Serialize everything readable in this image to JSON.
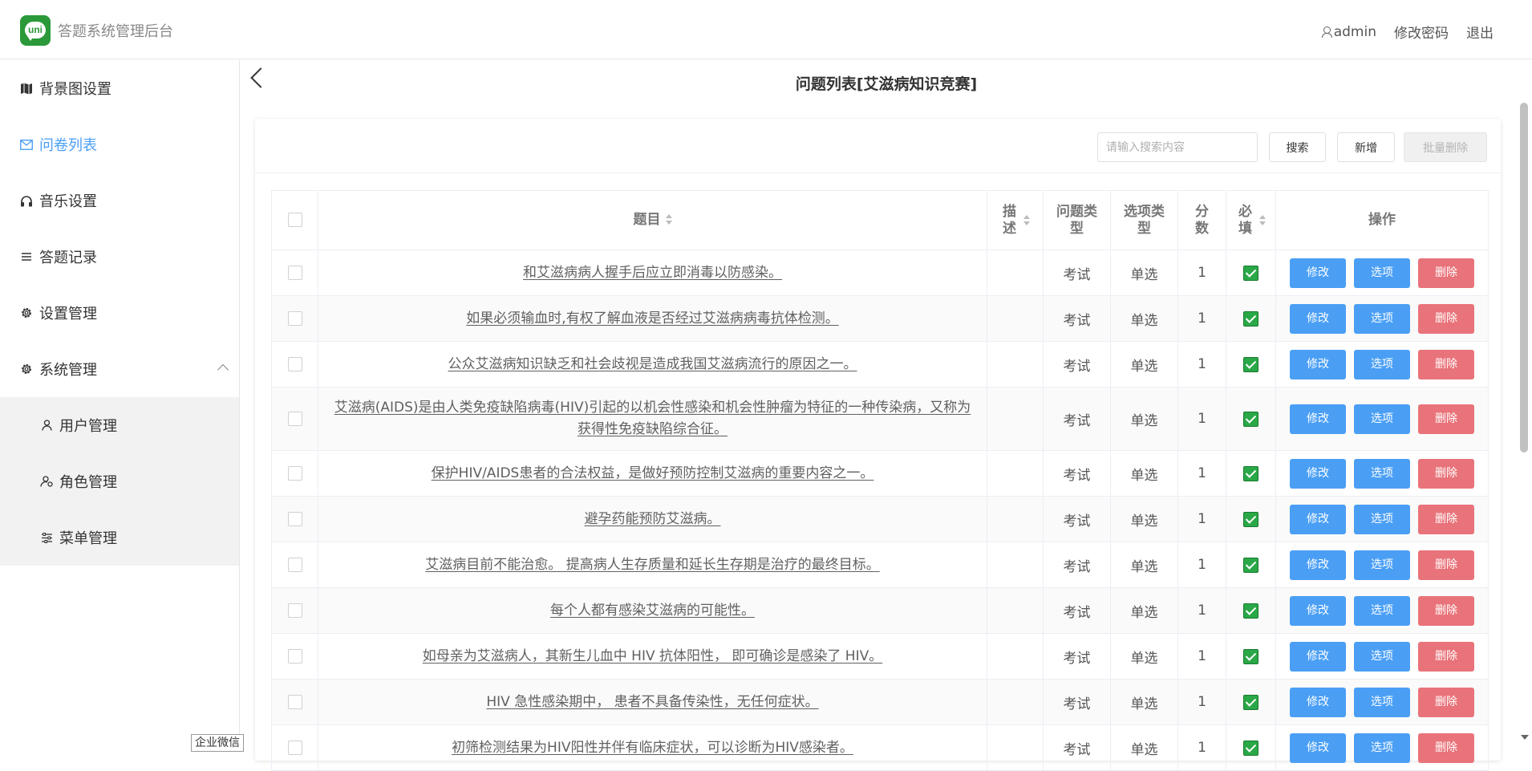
{
  "header": {
    "logo_text": "uni",
    "app_title": "答题系统管理后台",
    "username": "admin",
    "change_password": "修改密码",
    "logout": "退出"
  },
  "sidebar": {
    "items": [
      {
        "label": "背景图设置",
        "icon": "map-icon"
      },
      {
        "label": "问卷列表",
        "icon": "mail-icon",
        "active": true
      },
      {
        "label": "音乐设置",
        "icon": "headphones-icon"
      },
      {
        "label": "答题记录",
        "icon": "list-icon"
      },
      {
        "label": "设置管理",
        "icon": "gear-icon"
      },
      {
        "label": "系统管理",
        "icon": "gear-icon",
        "expanded": true
      }
    ],
    "submenu": [
      {
        "label": "用户管理",
        "icon": "user-icon"
      },
      {
        "label": "角色管理",
        "icon": "role-icon"
      },
      {
        "label": "菜单管理",
        "icon": "sliders-icon"
      }
    ]
  },
  "main": {
    "title": "问题列表[艾滋病知识竞赛]",
    "search_placeholder": "请输入搜索内容",
    "search_btn": "搜索",
    "add_btn": "新增",
    "batch_delete_btn": "批量删除"
  },
  "table": {
    "headers": {
      "question": "题目",
      "desc": "描述",
      "qtype": "问题类型",
      "otype": "选项类型",
      "score": "分数",
      "required": "必填",
      "ops": "操作"
    },
    "actions": {
      "edit": "修改",
      "options": "选项",
      "delete": "删除"
    },
    "rows": [
      {
        "question": "和艾滋病病人握手后应立即消毒以防感染。",
        "desc": "",
        "qtype": "考试",
        "otype": "单选",
        "score": "1"
      },
      {
        "question": "如果必须输血时,有权了解血液是否经过艾滋病病毒抗体检测。",
        "desc": "",
        "qtype": "考试",
        "otype": "单选",
        "score": "1"
      },
      {
        "question": "公众艾滋病知识缺乏和社会歧视是造成我国艾滋病流行的原因之一。",
        "desc": "",
        "qtype": "考试",
        "otype": "单选",
        "score": "1"
      },
      {
        "question": "艾滋病(AIDS)是由人类免疫缺陷病毒(HIV)引起的以机会性感染和机会性肿瘤为特征的一种传染病，又称为获得性免疫缺陷综合征。",
        "desc": "",
        "qtype": "考试",
        "otype": "单选",
        "score": "1"
      },
      {
        "question": "保护HIV/AIDS患者的合法权益，是做好预防控制艾滋病的重要内容之一。",
        "desc": "",
        "qtype": "考试",
        "otype": "单选",
        "score": "1"
      },
      {
        "question": "避孕药能预防艾滋病。",
        "desc": "",
        "qtype": "考试",
        "otype": "单选",
        "score": "1"
      },
      {
        "question": "艾滋病目前不能治愈。 提高病人生存质量和延长生存期是治疗的最终目标。",
        "desc": "",
        "qtype": "考试",
        "otype": "单选",
        "score": "1"
      },
      {
        "question": "每个人都有感染艾滋病的可能性。",
        "desc": "",
        "qtype": "考试",
        "otype": "单选",
        "score": "1"
      },
      {
        "question": "如母亲为艾滋病人，其新生儿血中 HIV 抗体阳性， 即可确诊是感染了 HIV。",
        "desc": "",
        "qtype": "考试",
        "otype": "单选",
        "score": "1"
      },
      {
        "question": "HIV 急性感染期中， 患者不具备传染性，无任何症状。",
        "desc": "",
        "qtype": "考试",
        "otype": "单选",
        "score": "1"
      },
      {
        "question": "初筛检测结果为HIV阳性并伴有临床症状，可以诊断为HIV感染者。",
        "desc": "",
        "qtype": "考试",
        "otype": "单选",
        "score": "1"
      }
    ]
  },
  "floating_tag": "企业微信"
}
